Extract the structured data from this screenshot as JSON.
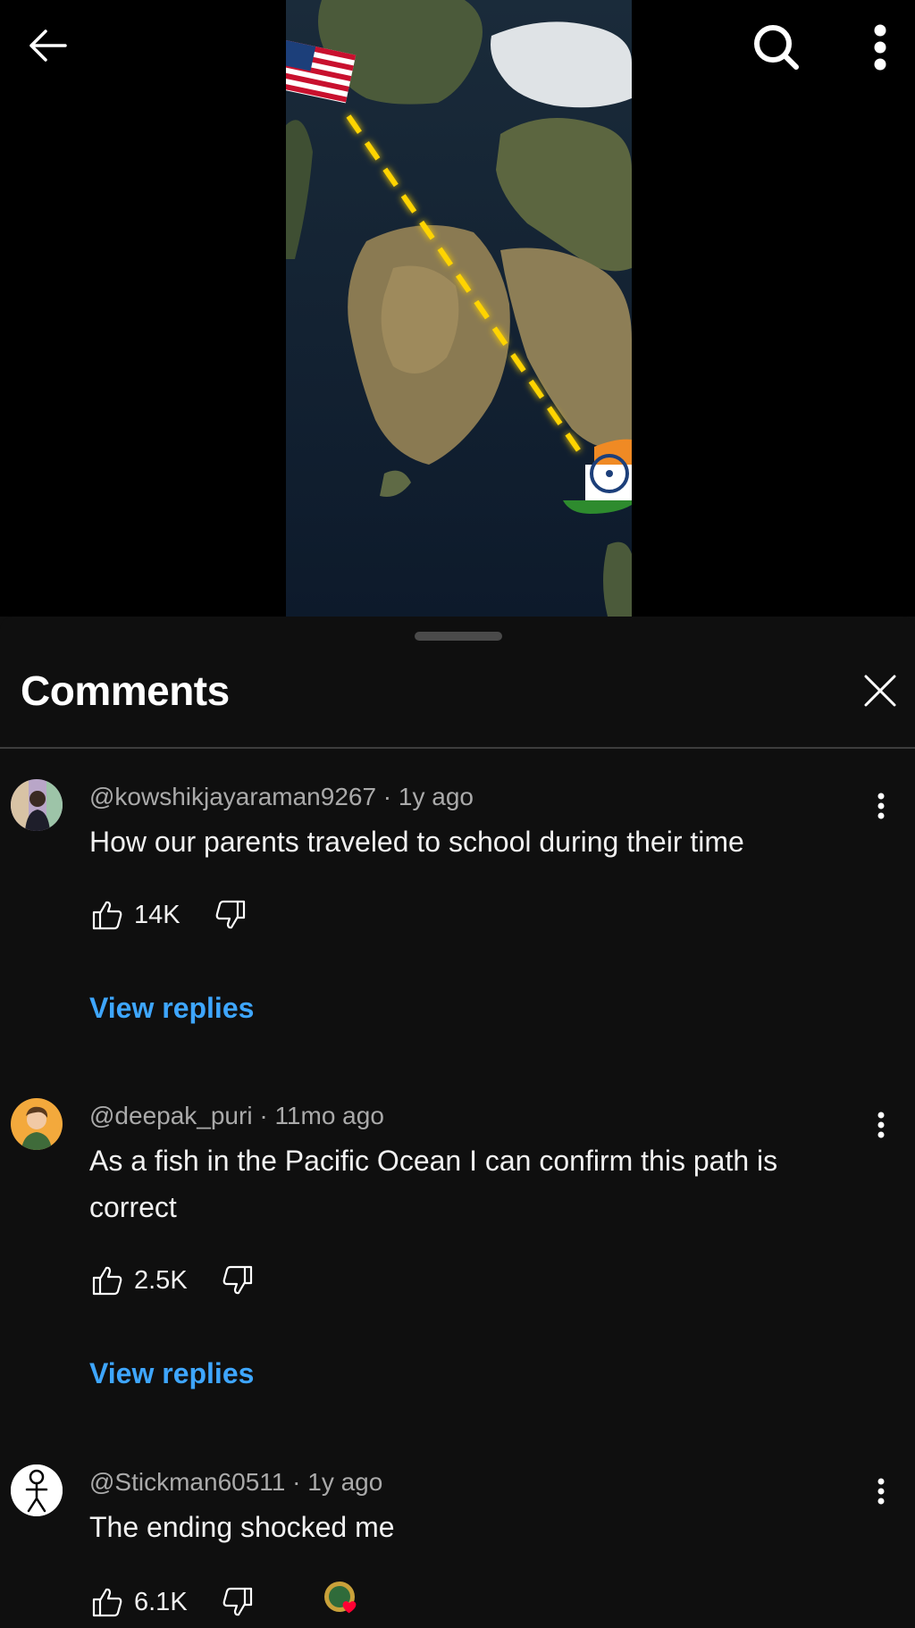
{
  "header": {
    "back_icon": "arrow-left-icon",
    "search_icon": "search-icon",
    "more_icon": "more-vert-icon"
  },
  "sheet": {
    "title": "Comments",
    "close_icon": "close-icon"
  },
  "comments": [
    {
      "author": "@kowshikjayaraman9267",
      "time": "1y ago",
      "text": "How our parents traveled to school during their time",
      "likes": "14K",
      "view_replies": "View replies"
    },
    {
      "author": "@deepak_puri",
      "time": "11mo ago",
      "text": "As a fish in the Pacific Ocean I can confirm this path is correct",
      "likes": "2.5K",
      "view_replies": "View replies"
    },
    {
      "author": "@Stickman60511",
      "time": "1y ago",
      "text": "The ending shocked me",
      "likes": "6.1K"
    }
  ],
  "colors": {
    "background": "#0f0f0f",
    "link": "#3ea6ff",
    "route": "#ffd400",
    "heart": "#ff0033"
  },
  "separator": " · "
}
